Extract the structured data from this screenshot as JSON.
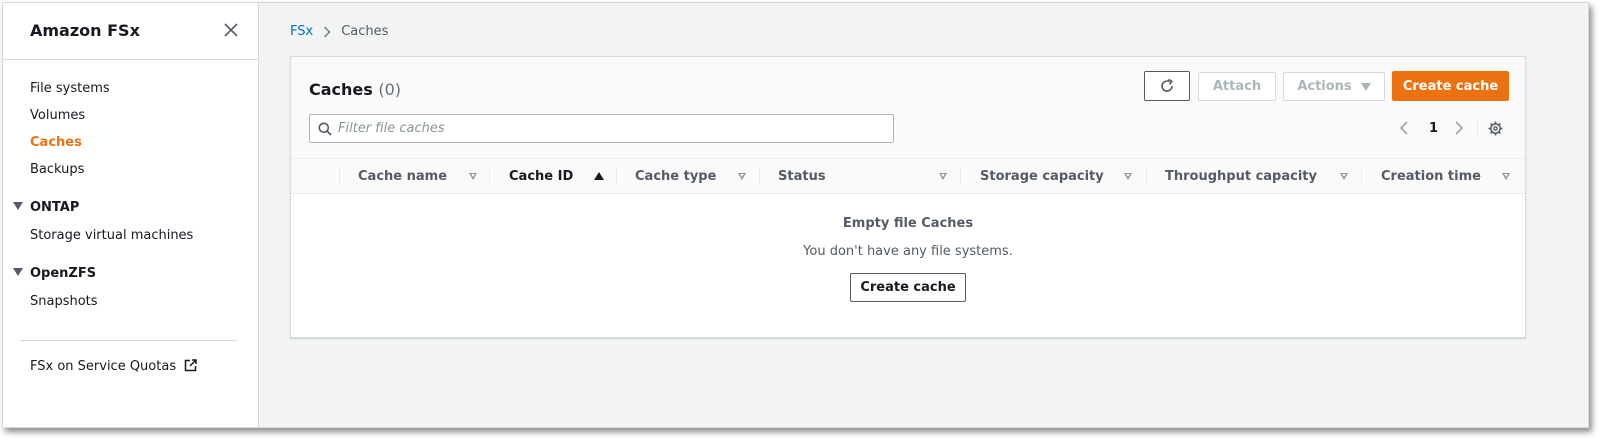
{
  "sidebar": {
    "title": "Amazon FSx",
    "items": [
      {
        "label": "File systems"
      },
      {
        "label": "Volumes"
      },
      {
        "label": "Caches",
        "active": true
      },
      {
        "label": "Backups"
      }
    ],
    "sections": [
      {
        "label": "ONTAP",
        "items": [
          {
            "label": "Storage virtual machines"
          }
        ]
      },
      {
        "label": "OpenZFS",
        "items": [
          {
            "label": "Snapshots"
          }
        ]
      }
    ],
    "footer_link": "FSx on Service Quotas"
  },
  "breadcrumb": {
    "root": "FSx",
    "current": "Caches"
  },
  "panel": {
    "title": "Caches",
    "count": "(0)",
    "buttons": {
      "refresh": "refresh-icon",
      "attach": "Attach",
      "actions": "Actions",
      "create": "Create cache"
    },
    "search_placeholder": "Filter file caches",
    "pagination": {
      "current_page": "1"
    }
  },
  "table": {
    "columns": [
      {
        "label": "Cache name",
        "sort": "none"
      },
      {
        "label": "Cache ID",
        "sort": "ascending"
      },
      {
        "label": "Cache type",
        "sort": "none"
      },
      {
        "label": "Status",
        "sort": "none"
      },
      {
        "label": "Storage capacity",
        "sort": "none"
      },
      {
        "label": "Throughput capacity",
        "sort": "none"
      },
      {
        "label": "Creation time",
        "sort": "none"
      }
    ],
    "empty": {
      "title": "Empty file Caches",
      "description": "You don't have any file systems.",
      "button": "Create cache"
    }
  },
  "colors": {
    "accent": "#ec7211",
    "link": "#0073bb",
    "text": "#16191f",
    "muted": "#545b64"
  }
}
